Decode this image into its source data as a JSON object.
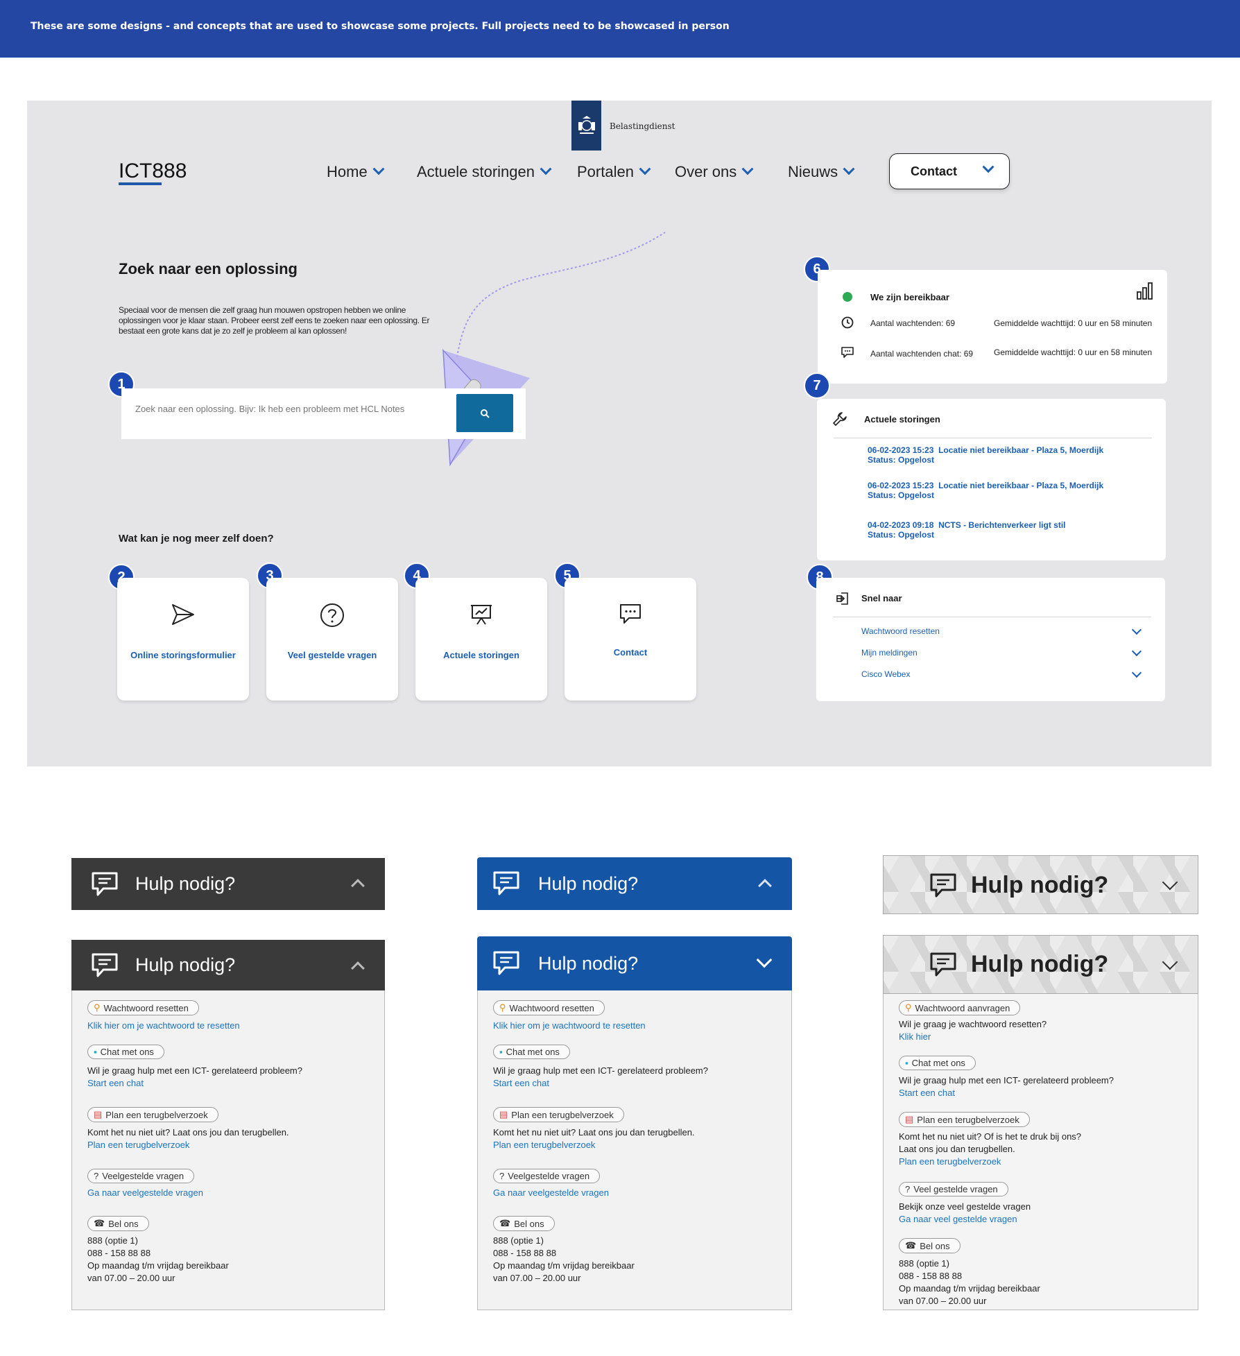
{
  "banner": {
    "text": "These are some designs - and concepts that are used to showcase some projects. Full projects need to be showcased in person"
  },
  "header": {
    "logo_text": "Belastingdienst",
    "brand": "ICT888",
    "nav": [
      "Home",
      "Actuele storingen",
      "Portalen",
      "Over ons",
      "Nieuws"
    ],
    "contact_label": "Contact"
  },
  "search": {
    "title": "Zoek naar een oplossing",
    "intro": "Speciaal voor de mensen die zelf graag hun mouwen opstropen hebben we online oplossingen voor je klaar staan. Probeer eerst zelf eens te zoeken naar een oplossing. Er bestaat een grote kans dat je zo zelf je probleem al kan oplossen!",
    "placeholder": "Zoek naar een oplossing. Bijv: Ik heb een probleem met HCL Notes"
  },
  "numbers": [
    "1",
    "2",
    "3",
    "4",
    "5",
    "6",
    "7",
    "8"
  ],
  "self_service": {
    "title": "Wat kan je nog meer zelf doen?",
    "tiles": [
      {
        "label": "Online storingsformulier",
        "icon": "send-icon"
      },
      {
        "label": "Veel gestelde vragen",
        "icon": "question-icon"
      },
      {
        "label": "Actuele storingen",
        "icon": "presentation-icon"
      },
      {
        "label": "Contact",
        "icon": "chat-icon"
      }
    ]
  },
  "availability": {
    "title": "We zijn bereikbaar",
    "status_color": "#2eaa55",
    "waiting_label": "Aantal wachtenden: 69",
    "waiting_time": "Gemiddelde wachttijd: 0 uur en 58 minuten",
    "chat_label": "Aantal wachtenden chat: 69",
    "chat_time": "Gemiddelde wachttijd: 0 uur en 58 minuten"
  },
  "outages": {
    "title": "Actuele storingen",
    "items": [
      {
        "date": "06-02-2023 15:23",
        "desc": "Locatie niet bereikbaar - Plaza 5, Moerdijk",
        "status": "Status: Opgelost"
      },
      {
        "date": "06-02-2023 15:23",
        "desc": "Locatie niet bereikbaar - Plaza 5, Moerdijk",
        "status": "Status: Opgelost"
      },
      {
        "date": "04-02-2023 09:18",
        "desc": "NCTS - Berichtenverkeer ligt stil",
        "status": "Status: Opgelost"
      }
    ]
  },
  "quick": {
    "title": "Snel naar",
    "items": [
      "Wachtwoord resetten",
      "Mijn meldingen",
      "Cisco Webex"
    ]
  },
  "help": {
    "title": "Hulp nodig?",
    "pw_pill": "Wachtwoord resetten",
    "pw_link": "Klik hier om je wachtwoord te resetten",
    "chat_pill": "Chat met ons",
    "chat_text": "Wil je graag hulp met een ICT- gerelateerd probleem?",
    "chat_link": "Start een chat",
    "plan_pill": "Plan een terugbelverzoek",
    "plan_text": "Komt het nu niet uit? Laat ons jou dan terugbellen.",
    "plan_link": "Plan een terugbelverzoek",
    "faq_pill": "Veelgestelde vragen",
    "faq_link": "Ga naar veelgestelde vragen",
    "call_pill": "Bel ons",
    "call_lines": [
      "888 (optie 1)",
      "088 - 158 88 88",
      "Op maandag t/m vrijdag bereikbaar",
      "van 07.00 – 20.00 uur"
    ],
    "alt": {
      "pw_pill": "Wachtwoord aanvragen",
      "pw_text": "Wil je graag je wachtwoord resetten?",
      "pw_link": "Klik hier",
      "plan_text1": "Komt het nu niet uit? Of is het te druk bij ons?",
      "plan_text2": "Laat ons jou dan terugbellen.",
      "faq_pill": "Veel gestelde vragen",
      "faq_text": "Bekijk onze veel gestelde vragen",
      "faq_link": "Ga naar veel gestelde vragen"
    }
  },
  "colors": {
    "banner": "#2547a4",
    "accent": "#1b48b1",
    "panel_dark": "#3a3a3a",
    "panel_blue": "#1456a5"
  }
}
